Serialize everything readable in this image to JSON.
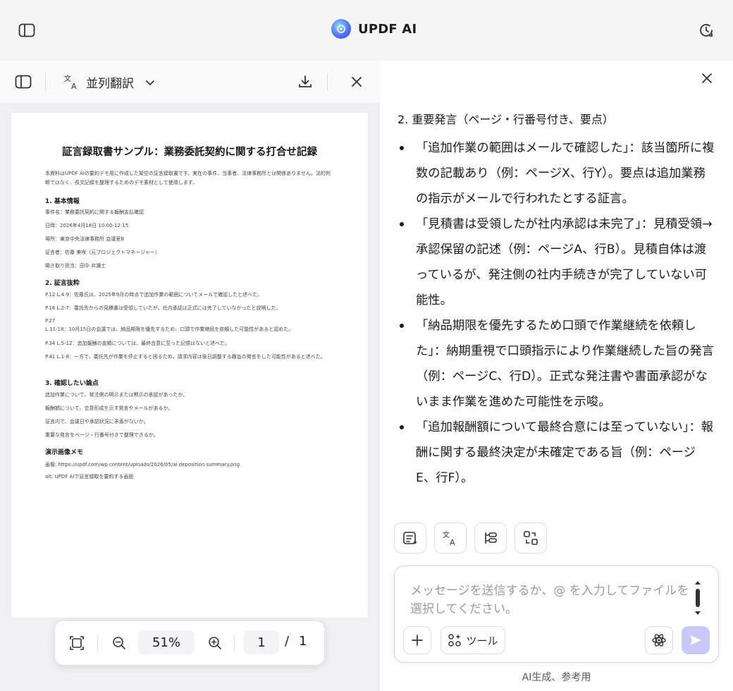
{
  "app": {
    "title": "UPDF AI"
  },
  "left_toolbar": {
    "mode_label": "並列翻訳"
  },
  "document": {
    "title": "証言録取書サンプル：業務委託契約に関する打合せ記録",
    "intro": "本資料はUPDF AIの要約デモ用に作成した架空の証言録取書です。実在の事件、当事者、法律事務所とは関係ありません。法的判断ではなく、長文記録を整理するためのデモ素材として使用します。",
    "sections": [
      {
        "heading": "1. 基本情報",
        "lines": [
          "事件名：業務委託契約に関する報酬支払確認",
          "日時：2026年4月18日 10:00-12:15",
          "場所：東京中央法律事務所 会議室B",
          "証言者：佐藤 美咲（元プロジェクトマネージャー）",
          "聞き取り担当：田中 弁護士"
        ]
      },
      {
        "heading": "2. 証言抜粋",
        "lines": [
          "P.12 L.4-9：佐藤氏は、2025年9月の時点で追加作業の範囲についてメールで確認したと述べた。",
          "P.18 L.2-7：委託先からの見積書は受領していたが、社内承認は正式には完了していなかったと説明した。",
          "P.27",
          "L.11-18：10月15日の会議では、納品期限を優先するため、口頭で作業継続を依頼した可能性があると認めた。",
          "P.34 L.5-12：追加報酬の金額については、最終合意に至った記憶はないと述べた。",
          "P.41 L.1-8：一方で、委託先が作業を停止すると困るため、請求内容は後日調整する趣旨の発言をした可能性があると述べた。"
        ]
      },
      {
        "heading": "3. 確認したい論点",
        "lines": [
          "追加作業について、発注側の明示または黙示の承認があったか。",
          "報酬額について、合意形成を示す発言やメールがあるか。",
          "証言内で、会議日や承認状況に矛盾がないか。",
          "重要な発言をページ・行番号付きで整理できるか。"
        ]
      },
      {
        "heading": "演示画像メモ",
        "lines": [
          "画像: https://updf.com/wp content/uploads/2026/05/ai deposition summary.png",
          "alt: UPDF AIで証言録取を要約する画面"
        ]
      }
    ]
  },
  "zoom": {
    "level": "51%",
    "page_current": "1",
    "page_sep": "/",
    "page_total": "1"
  },
  "chat": {
    "heading": "2. 重要発言（ページ・行番号付き、要点）",
    "bullets": [
      "「追加作業の範囲はメールで確認した」：該当箇所に複数の記載あり（例：ページX、行Y）。要点は追加業務の指示がメールで行われたとする証言。",
      "「見積書は受領したが社内承認は未完了」：見積受領→承認保留の記述（例：ページA、行B）。見積自体は渡っているが、発注側の社内手続きが完了していない可能性。",
      "「納品期限を優先するため口頭で作業継続を依頼した」：納期重視で口頭指示により作業継続した旨の発言（例：ページC、行D）。正式な発注書や書面承認がないまま作業を進めた可能性を示唆。",
      "「追加報酬額について最終合意には至っていない」：報酬に関する最終決定が未確定である旨（例：ページE、行F）。"
    ]
  },
  "input": {
    "placeholder": "メッセージを送信するか、@ を入力してファイルを選択してください。",
    "tools_label": "ツール"
  },
  "footer": {
    "note": "AI生成、参考用"
  },
  "colors": {
    "accent": "#c9c8fb",
    "brand": "#4a6cf7"
  }
}
